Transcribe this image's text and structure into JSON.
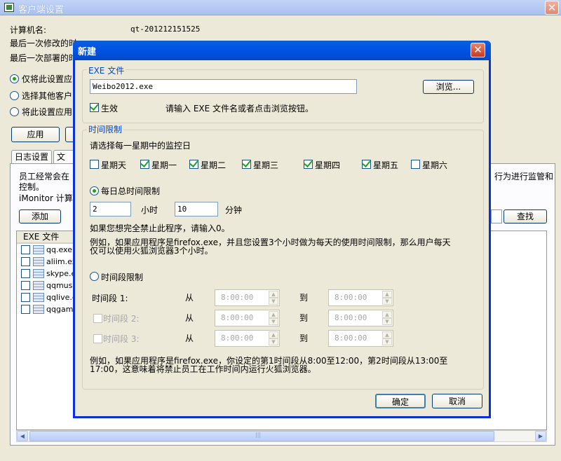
{
  "outer": {
    "title": "客户端设置",
    "computer_label": "计算机名:",
    "computer_value": "qt-201212151525",
    "last_modified_label": "最后一次修改的时",
    "last_deployed_label": "最后一次部署的时",
    "radio1": "仅将此设置应",
    "radio2": "选择其他客户",
    "radio3": "将此设置应用",
    "apply_button": "应用",
    "tab_log": "日志设置",
    "tab_doc": "文档",
    "desc_line1": "员工经常会在",
    "desc_line2": "控制。",
    "desc_right": "行为进行监管和",
    "imonitor_text": "iMonitor 计算机",
    "add_button": "添加",
    "find_button": "查找",
    "list_header": "EXE 文件",
    "list_items": [
      "qq.exe",
      "aliim.exe",
      "skype.e",
      "qqmusic",
      "qqlive.e",
      "qqgame"
    ]
  },
  "dialog": {
    "title": "新建",
    "exe_group_title": "EXE 文件",
    "exe_value": "Weibo2012.exe",
    "browse_button": "浏览...",
    "enabled_label": "生效",
    "enabled_checked": true,
    "exe_hint": "请输入 EXE 文件名或者点击浏览按钮。",
    "time_group_title": "时间限制",
    "weekday_prompt": "请选择每一星期中的监控日",
    "weekdays": [
      {
        "label": "星期天",
        "checked": false
      },
      {
        "label": "星期一",
        "checked": true
      },
      {
        "label": "星期二",
        "checked": true
      },
      {
        "label": "星期三",
        "checked": true
      },
      {
        "label": "星期四",
        "checked": true
      },
      {
        "label": "星期五",
        "checked": true
      },
      {
        "label": "星期六",
        "checked": false
      }
    ],
    "daily_limit_label": "每日总时间限制",
    "hours_value": "2",
    "hours_unit": "小时",
    "minutes_value": "10",
    "minutes_unit": "分钟",
    "forbid_hint": "如果您想完全禁止此程序，请输入0。",
    "example1_line1": "例如，如果应用程序是firefox.exe，并且您设置3个小时做为每天的使用时间限制，那么用户每天",
    "example1_line2": "仅可以使用火狐浏览器3个小时。",
    "period_limit_label": "时间段限制",
    "periods": [
      {
        "label": "时间段 1:",
        "from": "从",
        "start": "8:00:00",
        "to": "到",
        "end": "8:00:00"
      },
      {
        "label": "时间段 2:",
        "from": "从",
        "start": "8:00:00",
        "to": "到",
        "end": "8:00:00"
      },
      {
        "label": "时间段 3:",
        "from": "从",
        "start": "8:00:00",
        "to": "到",
        "end": "8:00:00"
      }
    ],
    "example2_line1": "例如，如果应用程序是firefox.exe，你设定的第1时间段从8:00至12:00，第2时间段从13:00至",
    "example2_line2": "17:00，这意味着将禁止员工在工作时间内运行火狐浏览器。",
    "ok_button": "确定",
    "cancel_button": "取消"
  }
}
